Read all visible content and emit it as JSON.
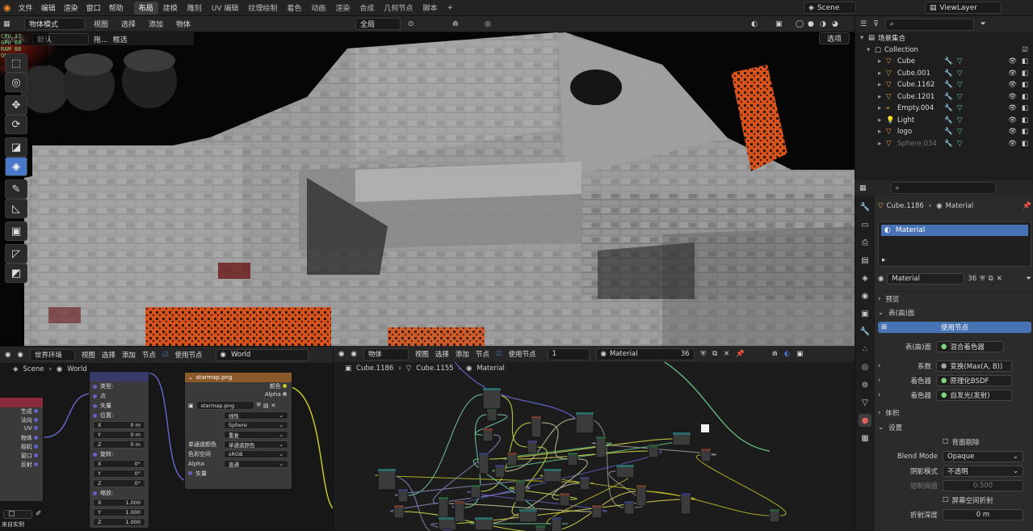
{
  "topbar": {
    "menus": [
      "文件",
      "编辑",
      "渲染",
      "窗口",
      "帮助"
    ],
    "workspaces": [
      "布局",
      "建模",
      "雕刻",
      "UV 编辑",
      "纹理绘制",
      "着色",
      "动画",
      "渲染",
      "合成",
      "几何节点",
      "脚本"
    ],
    "active_workspace": "布局",
    "add_tab": "+",
    "scene": "Scene",
    "viewlayer": "ViewLayer"
  },
  "stats": {
    "fps": "CPU 37",
    "ram": "RAM 88",
    "gpu": "GPU 60",
    "gpu2": "20.6",
    "ogl": "OGL 36",
    "line1": "27  88  20.5"
  },
  "viewport": {
    "mode": "物体模式",
    "menus": [
      "视图",
      "选择",
      "添加",
      "物体"
    ],
    "transform": "全局",
    "coord_label": "坐标系:",
    "coord_value": "默认",
    "pivot": "拖...",
    "select_mode": "框选",
    "options_btn": "选项"
  },
  "tools": [
    {
      "name": "select-box-tool",
      "glyph": "⬚",
      "active": false
    },
    {
      "name": "cursor-tool",
      "glyph": "◎",
      "active": false
    },
    {
      "name": "move-tool",
      "glyph": "✥",
      "active": false
    },
    {
      "name": "rotate-tool",
      "glyph": "⟳",
      "active": false
    },
    {
      "name": "scale-tool",
      "glyph": "◪",
      "active": false
    },
    {
      "name": "transform-tool",
      "glyph": "◈",
      "active": true
    },
    {
      "name": "annotate-tool",
      "glyph": "✎",
      "active": false
    },
    {
      "name": "measure-tool",
      "glyph": "◺",
      "active": false
    },
    {
      "name": "add-cube-tool",
      "glyph": "▣",
      "active": false
    },
    {
      "name": "extrude-tool",
      "glyph": "◸",
      "active": false
    },
    {
      "name": "shear-tool",
      "glyph": "◩",
      "active": false
    }
  ],
  "outliner": {
    "root": "场景集合",
    "collection": "Collection",
    "items": [
      {
        "name": "Cube",
        "muted": false
      },
      {
        "name": "Cube.001",
        "muted": false
      },
      {
        "name": "Cube.1162",
        "muted": false
      },
      {
        "name": "Cube.1201",
        "muted": false
      },
      {
        "name": "Empty.004",
        "muted": false
      },
      {
        "name": "Light",
        "muted": false
      },
      {
        "name": "logo",
        "muted": false
      },
      {
        "name": "Sphere.034",
        "muted": true
      }
    ]
  },
  "properties": {
    "object": "Cube.1186",
    "material_label": "Material",
    "slot": "Material",
    "material_name": "Material",
    "users": "36",
    "sections": {
      "preview": "预览",
      "surface": "表(曲)面",
      "use_nodes": "使用节点",
      "surface_label": "表(曲)面",
      "surface_value": "混合着色器",
      "factor_label": "系数",
      "factor_value": "变换(Max(A, B))",
      "shader1_label": "着色器",
      "shader1_value": "原理化BSDF",
      "shader2_label": "着色器",
      "shader2_value": "自发光(发射)",
      "volume": "体积",
      "settings": "设置",
      "backface": "背面剔除",
      "blend_label": "Blend Mode",
      "blend_value": "Opaque",
      "shadow_label": "阴影模式",
      "shadow_value": "不透明",
      "clip_label": "钳制阈值",
      "clip_value": "0.500",
      "screen_refr": "屏幕空间折射",
      "refr_label": "折射深度",
      "refr_value": "0 m"
    }
  },
  "node_editor_world": {
    "type": "世界环境",
    "menus": [
      "视图",
      "选择",
      "添加",
      "节点"
    ],
    "use_nodes": "使用节点",
    "world": "World",
    "breadcrumb": [
      "Scene",
      "World"
    ],
    "image_node_title": "starmap.png",
    "image_name": "starmap.png",
    "image_rows": [
      "线性",
      "Sphere",
      "重复",
      "单通道颜色",
      "sRGB",
      "直通"
    ],
    "image_labels": [
      "",
      "",
      "",
      "单通道颜色",
      "色彩空间",
      "Alpha"
    ],
    "out_color": "颜色",
    "out_alpha": "Alpha",
    "in_vector": "矢量",
    "mapping_rows": [
      "类型:",
      "点",
      "矢量",
      "位置:",
      "X",
      "Y",
      "Z",
      "旋转:",
      "X",
      "Y",
      "Z",
      "缩放:",
      "X",
      "Y",
      "Z"
    ],
    "mapping_values": [
      "0 m",
      "0 m",
      "0 m",
      "0°",
      "0°",
      "0°",
      "1.000",
      "1.000",
      "1.000"
    ],
    "texcoord_rows": [
      "生成",
      "法向",
      "UV",
      "物体",
      "相机",
      "窗口",
      "反射"
    ],
    "out_vector": "矢量",
    "footer": "来自实例"
  },
  "node_editor_shader": {
    "type": "物体",
    "menus": [
      "视图",
      "选择",
      "添加",
      "节点"
    ],
    "use_nodes": "使用节点",
    "slot": "1",
    "material": "Material",
    "users": "36",
    "breadcrumb": [
      "Cube.1186",
      "Cube.1155",
      "Material"
    ]
  }
}
